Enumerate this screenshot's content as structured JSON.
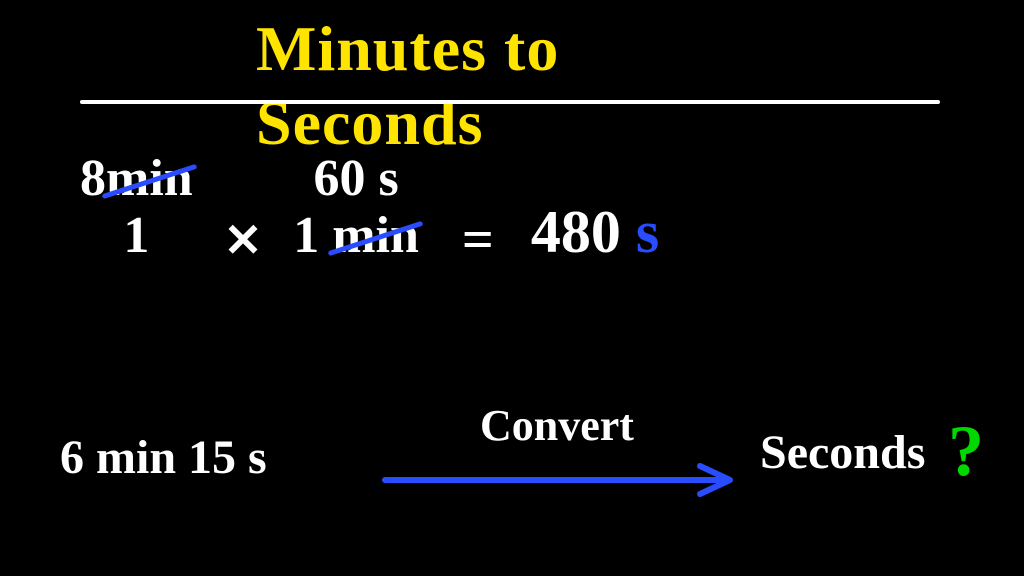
{
  "title": "Minutes to Seconds",
  "equation1": {
    "fraction1": {
      "num_value": "8",
      "num_unit": "min",
      "den": "1"
    },
    "fraction2": {
      "num_value": "60",
      "num_unit": "s",
      "den_value": "1",
      "den_unit": "min"
    },
    "result_value": "480",
    "result_unit": "s"
  },
  "equation2": {
    "input": "6 min  15 s",
    "action": "Convert",
    "target": "Seconds",
    "prompt": "?"
  }
}
